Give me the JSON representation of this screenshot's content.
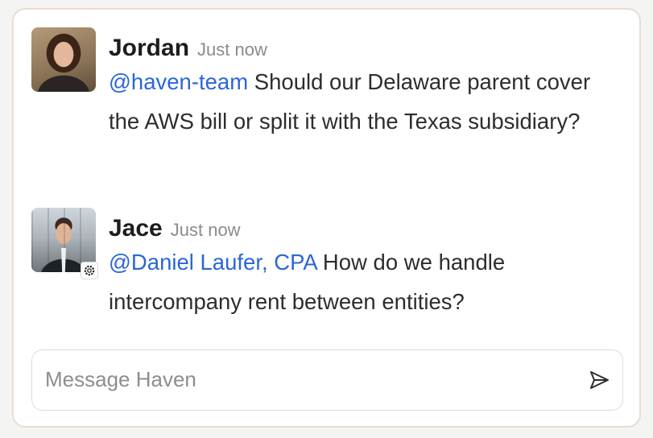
{
  "messages": [
    {
      "author": "Jordan",
      "time": "Just now",
      "mention": "@haven-team",
      "text": " Should our Delaware parent cover the AWS bill or split it with the Texas subsidiary?",
      "avatar": "photo-avatar-woman"
    },
    {
      "author": "Jace",
      "time": "Just now",
      "mention": "@Daniel Laufer, CPA",
      "text": " How do we handle intercompany rent between entities?",
      "avatar": "photo-avatar-man",
      "badge_icon": "gear-badge-icon"
    }
  ],
  "composer": {
    "placeholder": "Message Haven",
    "send_icon": "send-icon"
  },
  "colors": {
    "mention": "#2a66d9",
    "card_border": "#eaddcf",
    "timestamp": "#8b8b8b"
  }
}
